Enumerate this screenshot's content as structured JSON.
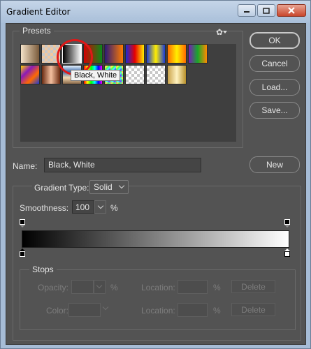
{
  "window": {
    "title": "Gradient Editor"
  },
  "presets": {
    "label": "Presets",
    "tooltip": "Black, White",
    "swatches": [
      {
        "name": "foreground-to-background",
        "bg": "linear-gradient(to right, #f4e2c8, #7a5a3a)"
      },
      {
        "name": "foreground-to-transparent",
        "bg": "checker-warm"
      },
      {
        "name": "black-white",
        "bg": "linear-gradient(to right, #000, #fff)"
      },
      {
        "name": "red-green",
        "bg": "linear-gradient(to right, #d40000, #0a8a1a)"
      },
      {
        "name": "violet-orange",
        "bg": "linear-gradient(to right, #2a1a78, #ff7a00)"
      },
      {
        "name": "blue-red-yellow",
        "bg": "linear-gradient(to right, #1a2ad8, #e80000, #ffee00)"
      },
      {
        "name": "blue-yellow-blue",
        "bg": "linear-gradient(to right, #1a3ad8, #ffee00, #1a3ad8)"
      },
      {
        "name": "orange-yellow-orange",
        "bg": "linear-gradient(to right, #ff6a00, #ffee00, #ff6a00)"
      },
      {
        "name": "violet-green-orange",
        "bg": "linear-gradient(to right, #7a1ab8, #19a82a, #ff8a00)"
      },
      {
        "name": "yellow-violet-orange-blue",
        "bg": "linear-gradient(135deg, #ffd400, #8a1ab8, #ff6a00, #1a3ad8)"
      },
      {
        "name": "copper",
        "bg": "linear-gradient(to right, #6a2a10, #f4c0a0, #6a2a10)"
      },
      {
        "name": "chrome",
        "bg": "linear-gradient(to bottom, #e8f4ff, #3a6aa8, #f4d8b0, #8a6a4a)"
      },
      {
        "name": "spectrum",
        "bg": "linear-gradient(to right, #ff0000, #ffff00, #00ff00, #00ffff, #0000ff, #ff00ff)"
      },
      {
        "name": "transparent-rainbow",
        "bg": "checker-rainbow"
      },
      {
        "name": "transparent-stripes",
        "bg": "checker"
      },
      {
        "name": "neutral-density",
        "bg": "checker"
      },
      {
        "name": "gold",
        "bg": "linear-gradient(to right, #c9a24a, #fff2c0, #b8902a)"
      }
    ]
  },
  "buttons": {
    "ok": "OK",
    "cancel": "Cancel",
    "load": "Load...",
    "save": "Save...",
    "new": "New"
  },
  "name": {
    "label": "Name:",
    "value": "Black, White"
  },
  "gradient": {
    "type_label": "Gradient Type:",
    "type_value": "Solid",
    "smoothness_label": "Smoothness:",
    "smoothness_value": "100",
    "smoothness_unit": "%",
    "start_color": "#000000",
    "end_color": "#ffffff"
  },
  "stops": {
    "label": "Stops",
    "opacity_label": "Opacity:",
    "opacity_unit": "%",
    "location_label": "Location:",
    "location_unit": "%",
    "delete_label": "Delete",
    "color_label": "Color:",
    "location2_label": "Location:",
    "location2_unit": "%",
    "delete2_label": "Delete"
  }
}
